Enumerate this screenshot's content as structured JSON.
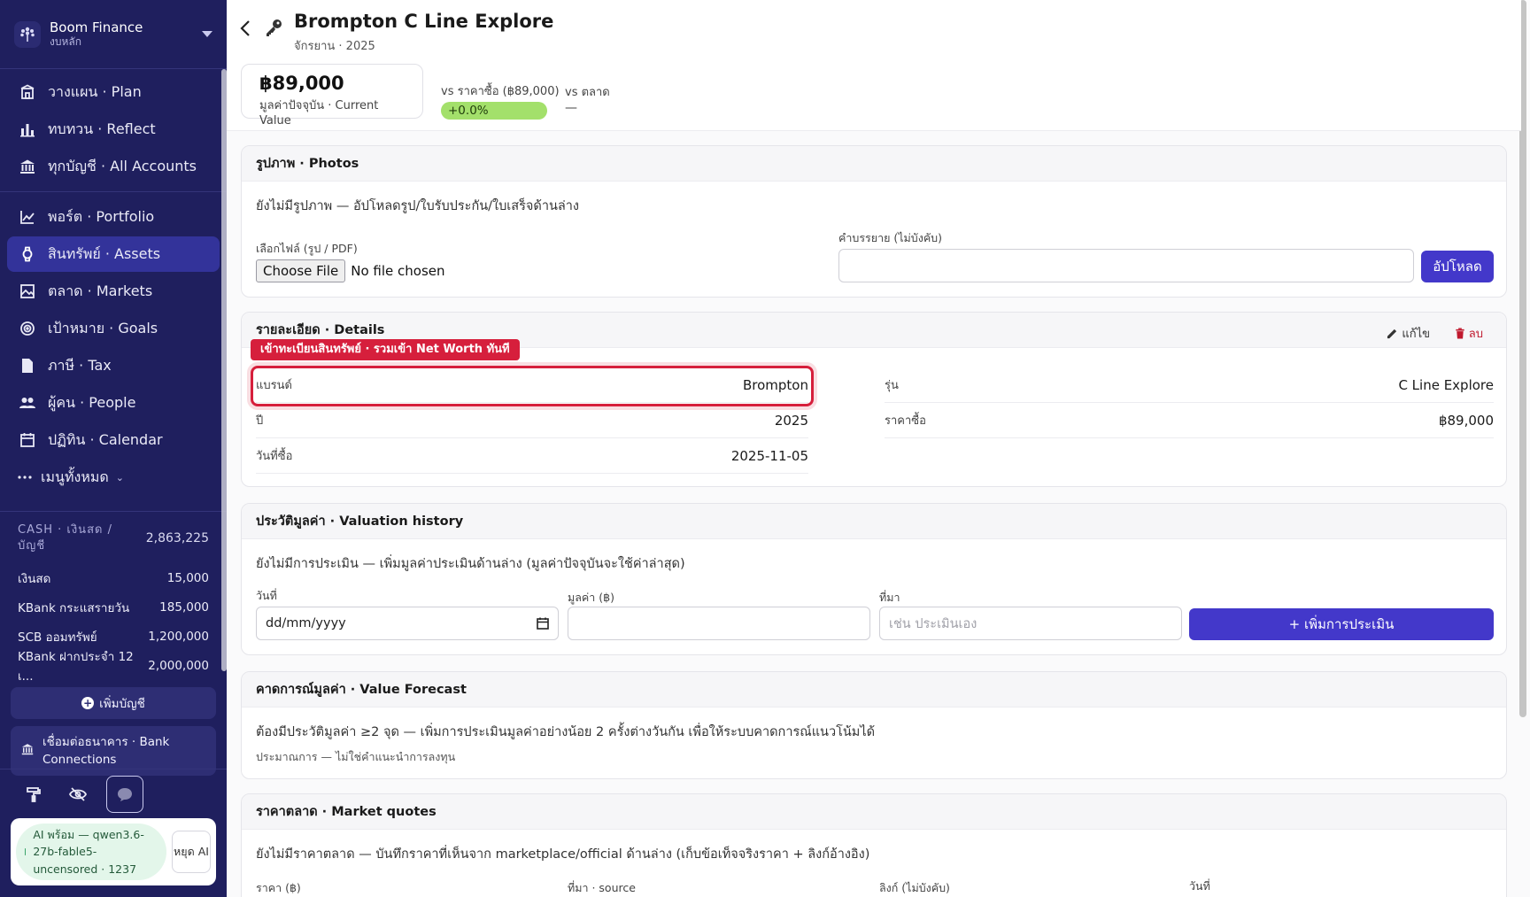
{
  "sidebar": {
    "brand": "Boom Finance",
    "subbrand": "งบหลัก",
    "nav": [
      {
        "label": "วางแผน · Plan",
        "icon": "plan-icon"
      },
      {
        "label": "ทบทวน · Reflect",
        "icon": "bar-chart-icon"
      },
      {
        "label": "ทุกบัญชี · All Accounts",
        "icon": "bank-icon"
      },
      {
        "label": "พอร์ต · Portfolio",
        "icon": "line-chart-icon"
      },
      {
        "label": "สินทรัพย์ · Assets",
        "icon": "watch-icon",
        "active": true
      },
      {
        "label": "ตลาด · Markets",
        "icon": "image-icon"
      },
      {
        "label": "เป้าหมาย · Goals",
        "icon": "target-icon"
      },
      {
        "label": "ภาษี · Tax",
        "icon": "document-icon"
      },
      {
        "label": "ผู้คน · People",
        "icon": "people-icon"
      },
      {
        "label": "ปฏิทิน · Calendar",
        "icon": "calendar-icon"
      }
    ],
    "more_label": "เมนูทั้งหมด",
    "cash": {
      "label": "CASH · เงินสด / บัญชี",
      "total": "2,863,225",
      "rows": [
        {
          "name": "เงินสด",
          "value": "15,000"
        },
        {
          "name": "KBank กระแสรายวัน",
          "value": "185,000"
        },
        {
          "name": "SCB ออมทรัพย์",
          "value": "1,200,000"
        },
        {
          "name": "KBank ฝากประจำ 12 เ...",
          "value": "2,000,000"
        }
      ]
    },
    "add_account": "เพิ่มบัญชี",
    "bank_connections": "เชื่อมต่อธนาคาร · Bank Connections",
    "ai_status": "AI พร้อม — qwen3.6-27b-fable5-uncensored · 1237",
    "ai_stop": "หยุด AI"
  },
  "header": {
    "title": "Brompton C Line Explore",
    "subtitle": "จักรยาน · 2025",
    "current_value": "฿89,000",
    "current_value_label": "มูลค่าปัจจุบัน · Current Value",
    "vs_purchase_label": "vs ราคาซื้อ (฿89,000)",
    "vs_purchase_value": "+0.0%",
    "vs_market_label": "vs ตลาด",
    "vs_market_value": "—"
  },
  "photos": {
    "title": "รูปภาพ · Photos",
    "empty": "ยังไม่มีรูปภาพ — อัปโหลดรูป/ใบรับประกัน/ใบเสร็จด้านล่าง",
    "file_label": "เลือกไฟล์ (รูป / PDF)",
    "choose_file": "Choose File",
    "no_file": "No file chosen",
    "desc_label": "คำบรรยาย (ไม่บังคับ)",
    "upload": "อัปโหลด"
  },
  "details": {
    "title": "รายละเอียด · Details",
    "edit": "แก้ไข",
    "delete": "ลบ",
    "highlight_tag": "เข้าทะเบียนสินทรัพย์ · รวมเข้า Net Worth ทันที",
    "rows_left": [
      {
        "k": "แบรนด์",
        "v": "Brompton"
      },
      {
        "k": "ปี",
        "v": "2025"
      },
      {
        "k": "วันที่ซื้อ",
        "v": "2025-11-05"
      }
    ],
    "rows_right": [
      {
        "k": "รุ่น",
        "v": "C Line Explore"
      },
      {
        "k": "ราคาซื้อ",
        "v": "฿89,000"
      }
    ]
  },
  "valuation": {
    "title": "ประวัติมูลค่า · Valuation history",
    "empty": "ยังไม่มีการประเมิน — เพิ่มมูลค่าประเมินด้านล่าง (มูลค่าปัจจุบันจะใช้ค่าล่าสุด)",
    "date_label": "วันที่",
    "date_placeholder": "dd/mm/yyyy",
    "value_label": "มูลค่า (฿)",
    "source_label": "ที่มา",
    "source_placeholder": "เช่น ประเมินเอง",
    "add": "+ เพิ่มการประเมิน"
  },
  "forecast": {
    "title": "คาดการณ์มูลค่า · Value Forecast",
    "text": "ต้องมีประวัติมูลค่า ≥2 จุด — เพิ่มการประเมินมูลค่าอย่างน้อย 2 ครั้งต่างวันกัน เพื่อให้ระบบคาดการณ์แนวโน้มได้",
    "note": "ประมาณการ — ไม่ใช่คำแนะนำการลงทุน"
  },
  "quotes": {
    "title": "ราคาตลาด · Market quotes",
    "empty": "ยังไม่มีราคาตลาด — บันทึกราคาที่เห็นจาก marketplace/official ด้านล่าง (เก็บข้อเท็จจริงราคา + ลิงก์อ้างอิง)",
    "price_label": "ราคา (฿)",
    "source_label": "ที่มา · source",
    "link_label": "ลิงก์ (ไม่บังคับ)",
    "date_label": "วันที่"
  },
  "colors": {
    "sidebar_bg": "#1f1f5e",
    "accent": "#4338ca",
    "highlight": "#d61f3c",
    "positive": "#a3e06b"
  }
}
